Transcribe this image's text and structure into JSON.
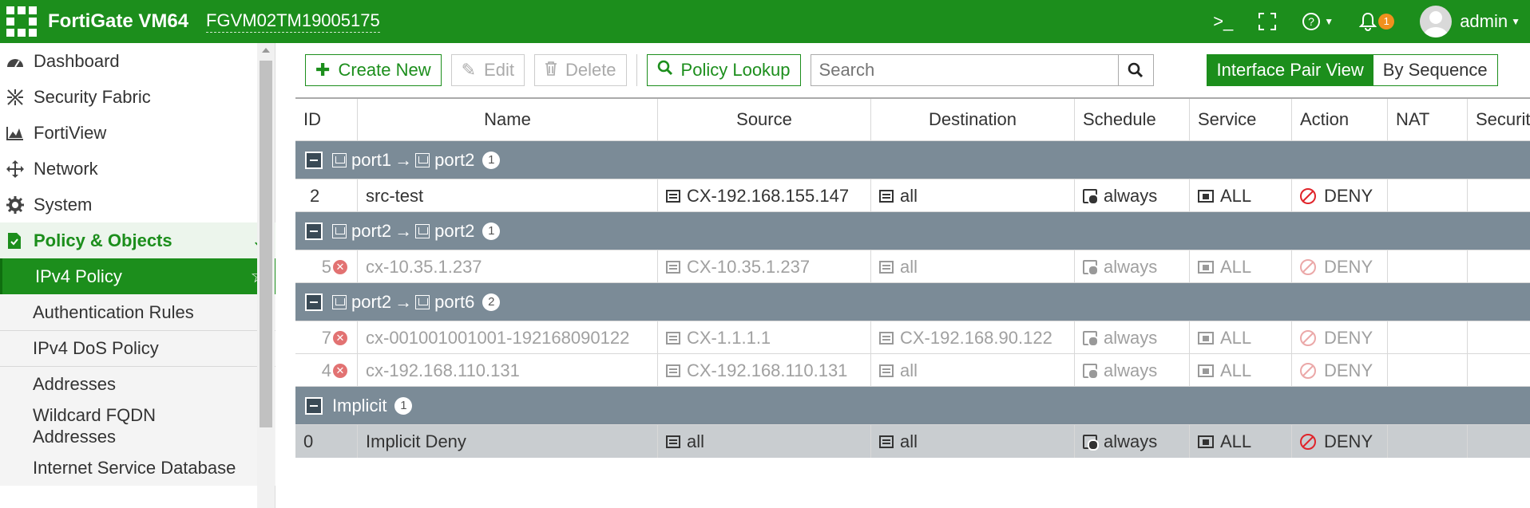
{
  "header": {
    "app_title": "FortiGate VM64",
    "serial": "FGVM02TM19005175",
    "cli_icon": ">_",
    "notifications_count": "1",
    "user": "admin",
    "brand_color": "#1c8e1c"
  },
  "sidebar": {
    "items": [
      {
        "label": "Dashboard",
        "icon": "dashboard-icon"
      },
      {
        "label": "Security Fabric",
        "icon": "security-fabric-icon"
      },
      {
        "label": "FortiView",
        "icon": "fortiview-icon"
      },
      {
        "label": "Network",
        "icon": "network-icon"
      },
      {
        "label": "System",
        "icon": "gear-icon"
      },
      {
        "label": "Policy & Objects",
        "icon": "policy-icon"
      }
    ],
    "sub_items": [
      {
        "label": "IPv4 Policy"
      },
      {
        "label": "Authentication Rules"
      },
      {
        "label": "IPv4 DoS Policy"
      },
      {
        "label": "Addresses"
      },
      {
        "label": "Wildcard FQDN Addresses"
      },
      {
        "label": "Internet Service Database"
      }
    ]
  },
  "toolbar": {
    "create_new": "Create New",
    "edit": "Edit",
    "delete": "Delete",
    "policy_lookup": "Policy Lookup",
    "search_placeholder": "Search",
    "view_interface_pair": "Interface Pair View",
    "view_by_sequence": "By Sequence"
  },
  "table": {
    "columns": [
      "ID",
      "Name",
      "Source",
      "Destination",
      "Schedule",
      "Service",
      "Action",
      "NAT",
      "Securit"
    ],
    "groups": [
      {
        "from": "port1",
        "to": "port2",
        "count": "1",
        "rows": [
          {
            "id": "2",
            "name": "src-test",
            "source": "CX-192.168.155.147",
            "destination": "all",
            "schedule": "always",
            "service": "ALL",
            "action": "DENY",
            "disabled": false
          }
        ]
      },
      {
        "from": "port2",
        "to": "port2",
        "count": "1",
        "rows": [
          {
            "id": "5",
            "name": "cx-10.35.1.237",
            "source": "CX-10.35.1.237",
            "destination": "all",
            "schedule": "always",
            "service": "ALL",
            "action": "DENY",
            "disabled": true
          }
        ]
      },
      {
        "from": "port2",
        "to": "port6",
        "count": "2",
        "rows": [
          {
            "id": "7",
            "name": "cx-001001001001-192168090122",
            "source": "CX-1.1.1.1",
            "destination": "CX-192.168.90.122",
            "schedule": "always",
            "service": "ALL",
            "action": "DENY",
            "disabled": true
          },
          {
            "id": "4",
            "name": "cx-192.168.110.131",
            "source": "CX-192.168.110.131",
            "destination": "all",
            "schedule": "always",
            "service": "ALL",
            "action": "DENY",
            "disabled": true
          }
        ]
      }
    ],
    "implicit": {
      "label": "Implicit",
      "count": "1",
      "row": {
        "id": "0",
        "name": "Implicit Deny",
        "source": "all",
        "destination": "all",
        "schedule": "always",
        "service": "ALL",
        "action": "DENY"
      }
    },
    "arrow": "→"
  }
}
